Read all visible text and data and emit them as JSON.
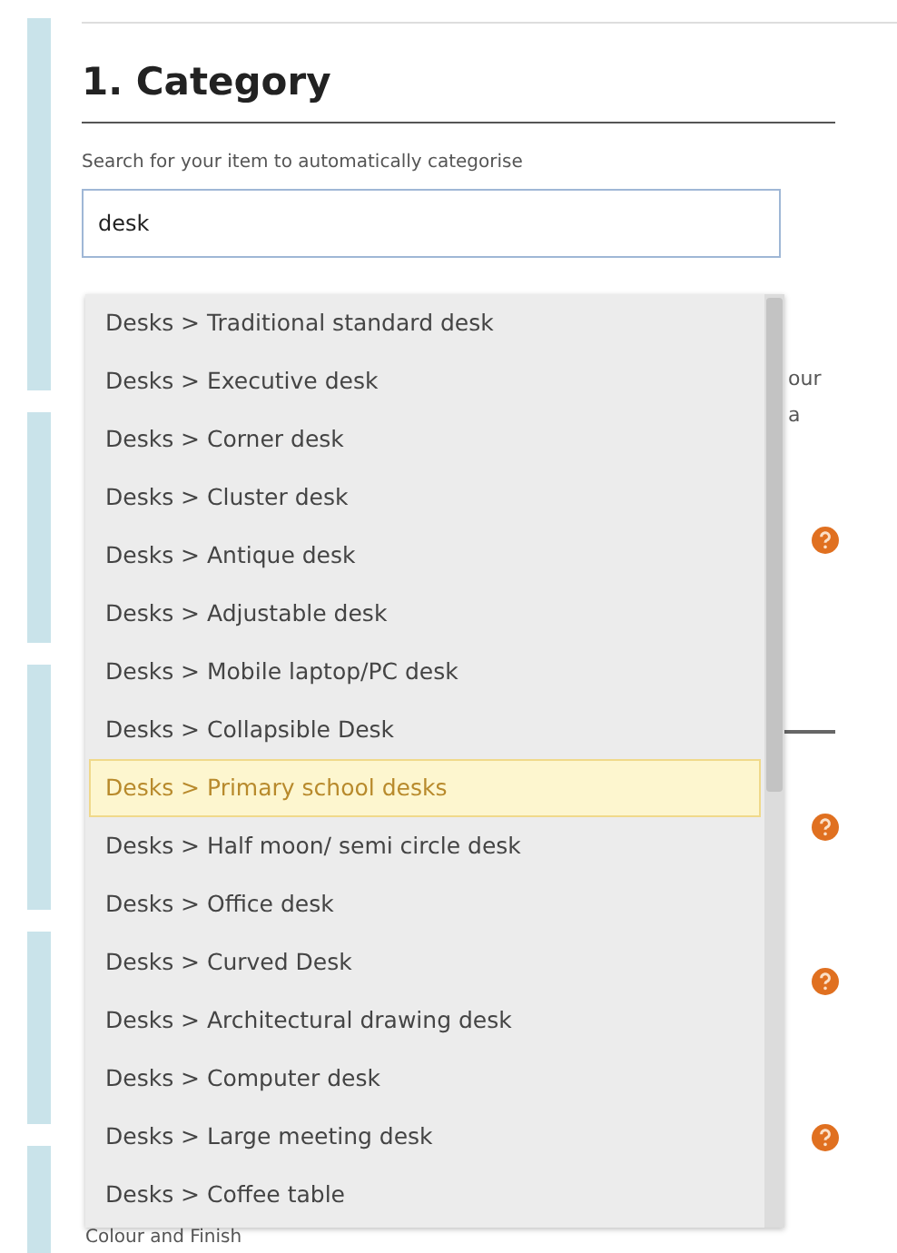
{
  "section": {
    "heading": "1. Category",
    "search_label": "Search for your item to automatically categorise"
  },
  "search": {
    "value": "desk"
  },
  "suggestions": [
    {
      "label": "Desks > Traditional standard desk",
      "selected": false
    },
    {
      "label": "Desks > Executive desk",
      "selected": false
    },
    {
      "label": "Desks > Corner desk",
      "selected": false
    },
    {
      "label": "Desks > Cluster desk",
      "selected": false
    },
    {
      "label": "Desks > Antique desk",
      "selected": false
    },
    {
      "label": "Desks > Adjustable desk",
      "selected": false
    },
    {
      "label": "Desks > Mobile laptop/PC desk",
      "selected": false
    },
    {
      "label": "Desks > Collapsible Desk",
      "selected": false
    },
    {
      "label": "Desks > Primary school desks",
      "selected": true
    },
    {
      "label": "Desks > Half moon/ semi circle desk",
      "selected": false
    },
    {
      "label": "Desks > Office desk",
      "selected": false
    },
    {
      "label": "Desks > Curved Desk",
      "selected": false
    },
    {
      "label": "Desks > Architectural drawing desk",
      "selected": false
    },
    {
      "label": "Desks > Computer desk",
      "selected": false
    },
    {
      "label": "Desks > Large meeting desk",
      "selected": false
    },
    {
      "label": "Desks > Coffee table",
      "selected": false
    }
  ],
  "partial_texts": [
    "our",
    "a"
  ],
  "next_label": "Colour and Finish"
}
